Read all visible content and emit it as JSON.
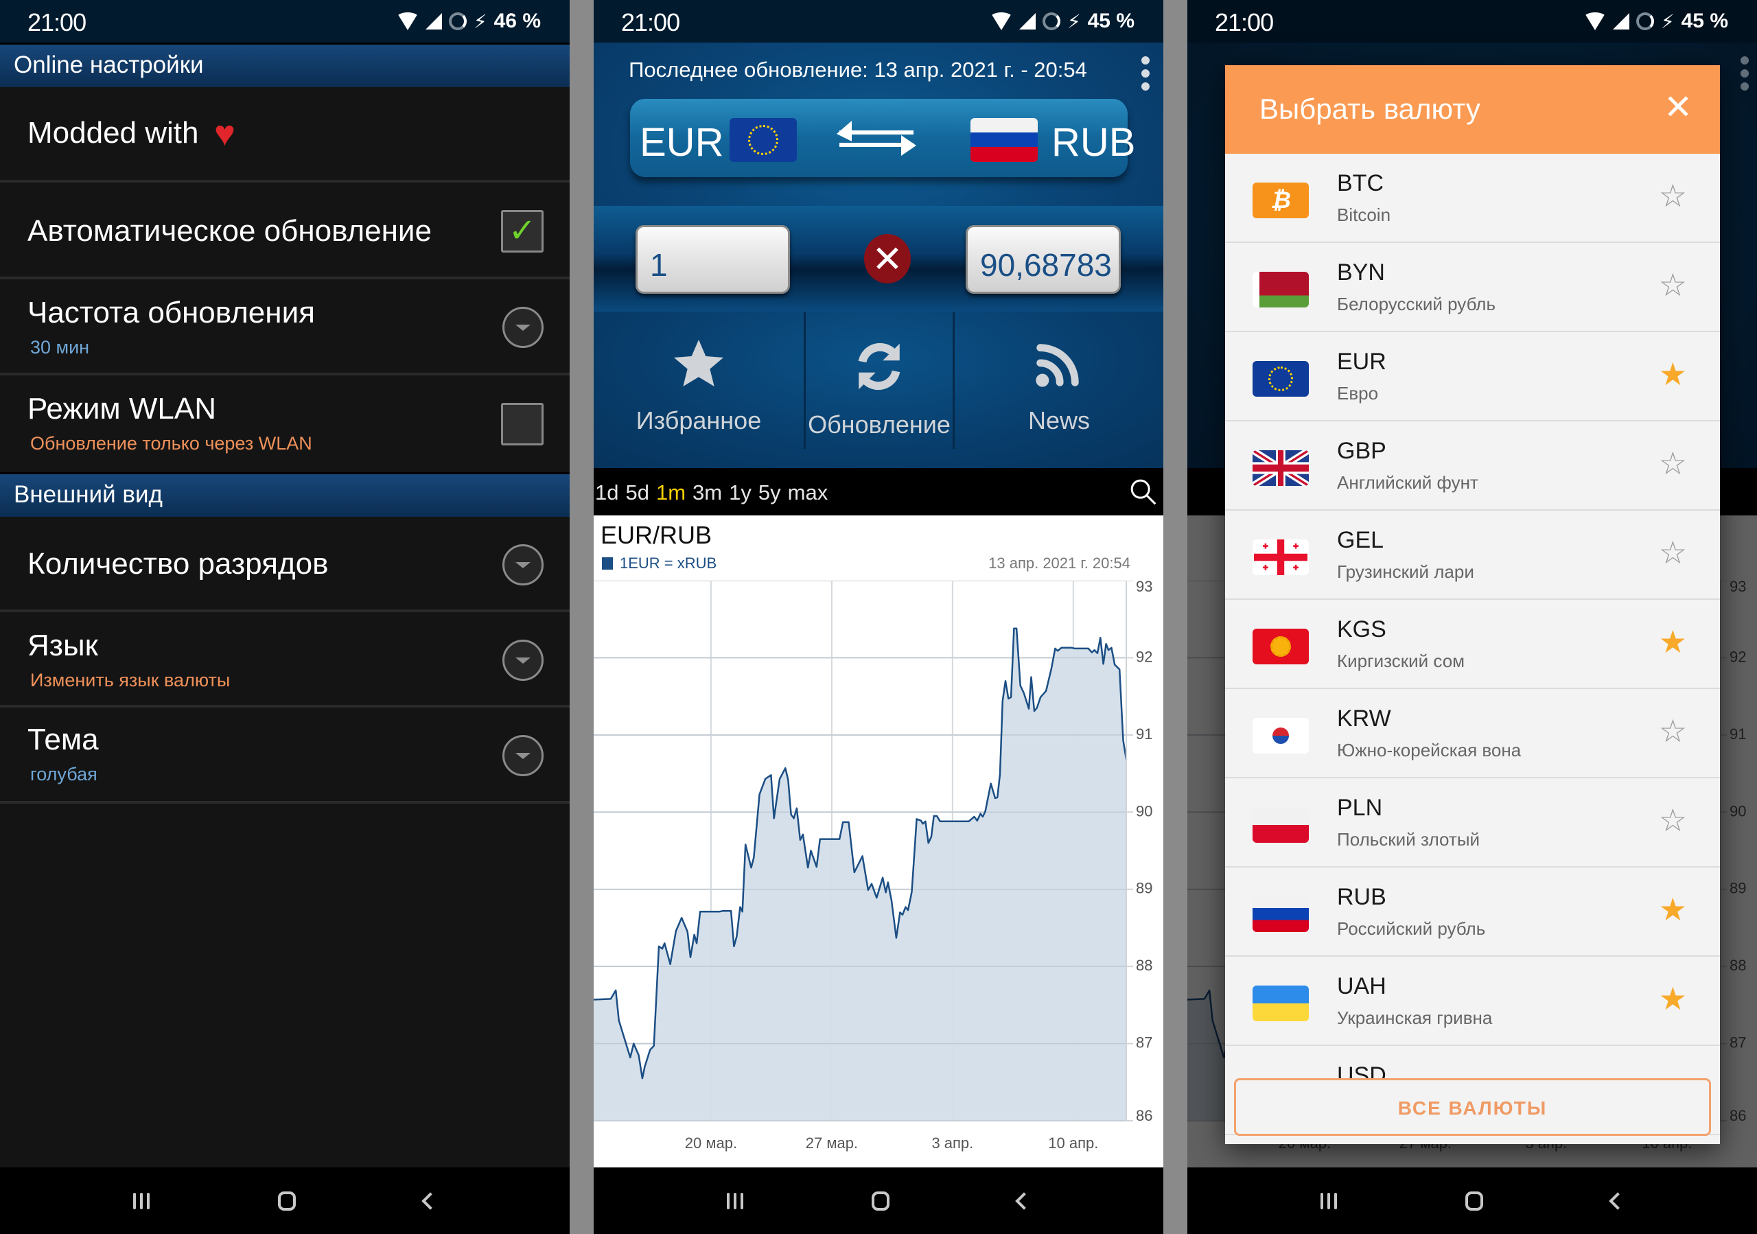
{
  "status_bars": [
    {
      "time": "21:00",
      "battery": "46 %"
    },
    {
      "time": "21:00",
      "battery": "45 %"
    },
    {
      "time": "21:00",
      "battery": "45 %"
    }
  ],
  "settings": {
    "section_online": "Online настройки",
    "modded": {
      "title": "Modded with",
      "icon": "heart-icon"
    },
    "auto_update": {
      "title": "Автоматическое обновление",
      "checked": true
    },
    "frequency": {
      "title": "Частота обновления",
      "value": "30 мин"
    },
    "wlan": {
      "title": "Режим WLAN",
      "subtitle": "Обновление только через WLAN",
      "checked": false
    },
    "section_appearance": "Внешний вид",
    "digits": {
      "title": "Количество разрядов"
    },
    "language": {
      "title": "Язык",
      "subtitle": "Изменить язык валюты"
    },
    "theme": {
      "title": "Тема",
      "value": "голубая"
    }
  },
  "converter": {
    "last_update": "Последнее обновление: 13 апр. 2021 г. - 20:54",
    "from_currency": "EUR",
    "to_currency": "RUB",
    "amount_input": "1",
    "result": "90,68783",
    "actions": [
      {
        "label": "Избранное",
        "icon": "star-icon"
      },
      {
        "label": "Обновление",
        "icon": "refresh-icon"
      },
      {
        "label": "News",
        "icon": "rss-icon"
      }
    ],
    "ranges": [
      "1d",
      "5d",
      "1m",
      "3m",
      "1y",
      "5y",
      "max"
    ],
    "active_range": "1m"
  },
  "chart_data": {
    "type": "area",
    "title": "EUR/RUB",
    "legend": "1EUR = xRUB",
    "timestamp": "13 апр. 2021 г. 20:54",
    "xlabel": "",
    "ylabel": "",
    "x_unit": "days since 20 мар. 2021",
    "xlim": [
      -6.8,
      24.07
    ],
    "ylim": [
      86,
      93
    ],
    "y_ticks": [
      86,
      87,
      88,
      89,
      90,
      91,
      92,
      93
    ],
    "x_ticks": [
      {
        "x": 0,
        "label": "20 мар."
      },
      {
        "x": 7,
        "label": "27 мар."
      },
      {
        "x": 14,
        "label": "3 апр."
      },
      {
        "x": 21,
        "label": "10 апр."
      }
    ],
    "grid": true,
    "y_axis_side": "right",
    "series": [
      {
        "name": "1EUR = xRUB",
        "color": "#1b4e84",
        "fill": "#d3dee9",
        "points": [
          [
            -6.8,
            87.57
          ],
          [
            -5.81,
            87.58
          ],
          [
            -5.52,
            87.69
          ],
          [
            -5.34,
            87.3
          ],
          [
            -4.68,
            86.82
          ],
          [
            -4.48,
            87.0
          ],
          [
            -4.19,
            86.85
          ],
          [
            -3.98,
            86.55
          ],
          [
            -3.84,
            86.7
          ],
          [
            -3.53,
            86.92
          ],
          [
            -3.31,
            86.97
          ],
          [
            -3.02,
            88.26
          ],
          [
            -2.82,
            88.23
          ],
          [
            -2.69,
            88.3
          ],
          [
            -2.36,
            88.03
          ],
          [
            -2.03,
            88.46
          ],
          [
            -1.7,
            88.63
          ],
          [
            -1.36,
            88.45
          ],
          [
            -1.19,
            88.12
          ],
          [
            -0.97,
            88.41
          ],
          [
            -0.83,
            88.3
          ],
          [
            -0.63,
            88.71
          ],
          [
            0.49,
            88.71
          ],
          [
            0.69,
            88.72
          ],
          [
            1.16,
            88.72
          ],
          [
            1.33,
            88.26
          ],
          [
            1.49,
            88.39
          ],
          [
            1.69,
            88.77
          ],
          [
            1.82,
            88.71
          ],
          [
            2.0,
            89.58
          ],
          [
            2.33,
            89.28
          ],
          [
            2.48,
            89.41
          ],
          [
            2.81,
            90.23
          ],
          [
            3.15,
            90.43
          ],
          [
            3.48,
            90.48
          ],
          [
            3.65,
            89.92
          ],
          [
            3.98,
            90.43
          ],
          [
            4.31,
            90.57
          ],
          [
            4.47,
            90.42
          ],
          [
            4.64,
            89.97
          ],
          [
            4.8,
            89.92
          ],
          [
            4.97,
            90.05
          ],
          [
            5.17,
            89.64
          ],
          [
            5.33,
            89.71
          ],
          [
            5.62,
            89.28
          ],
          [
            5.79,
            89.5
          ],
          [
            6.12,
            89.29
          ],
          [
            6.32,
            89.65
          ],
          [
            7.45,
            89.65
          ],
          [
            7.65,
            89.87
          ],
          [
            7.98,
            89.87
          ],
          [
            8.31,
            89.22
          ],
          [
            8.78,
            89.43
          ],
          [
            9.11,
            88.99
          ],
          [
            9.31,
            89.07
          ],
          [
            9.6,
            88.89
          ],
          [
            9.95,
            89.15
          ],
          [
            10.13,
            88.96
          ],
          [
            10.26,
            89.09
          ],
          [
            10.46,
            88.86
          ],
          [
            10.74,
            88.37
          ],
          [
            10.96,
            88.7
          ],
          [
            11.1,
            88.67
          ],
          [
            11.28,
            88.77
          ],
          [
            11.42,
            88.73
          ],
          [
            11.58,
            88.9
          ],
          [
            11.64,
            88.97
          ],
          [
            11.92,
            89.91
          ],
          [
            12.17,
            89.89
          ],
          [
            12.28,
            89.85
          ],
          [
            12.43,
            89.88
          ],
          [
            12.6,
            89.6
          ],
          [
            12.77,
            89.68
          ],
          [
            12.92,
            89.95
          ],
          [
            13.09,
            89.95
          ],
          [
            13.28,
            89.88
          ],
          [
            14.3,
            89.88
          ],
          [
            14.51,
            89.88
          ],
          [
            14.94,
            89.88
          ],
          [
            15.26,
            89.94
          ],
          [
            15.43,
            89.89
          ],
          [
            15.62,
            89.98
          ],
          [
            15.75,
            89.94
          ],
          [
            15.9,
            90.01
          ],
          [
            16.22,
            90.37
          ],
          [
            16.47,
            90.18
          ],
          [
            16.6,
            90.19
          ],
          [
            16.75,
            90.49
          ],
          [
            16.9,
            91.44
          ],
          [
            17.07,
            91.7
          ],
          [
            17.24,
            91.47
          ],
          [
            17.39,
            91.49
          ],
          [
            17.56,
            92.38
          ],
          [
            17.71,
            92.38
          ],
          [
            17.93,
            91.64
          ],
          [
            18.14,
            91.54
          ],
          [
            18.42,
            91.34
          ],
          [
            18.56,
            91.75
          ],
          [
            18.74,
            91.31
          ],
          [
            18.89,
            91.35
          ],
          [
            19.1,
            91.49
          ],
          [
            19.42,
            91.57
          ],
          [
            19.73,
            91.86
          ],
          [
            19.95,
            92.12
          ],
          [
            20.1,
            92.09
          ],
          [
            20.31,
            92.13
          ],
          [
            20.91,
            92.13
          ],
          [
            21.08,
            92.12
          ],
          [
            21.87,
            92.12
          ],
          [
            22.08,
            92.07
          ],
          [
            22.23,
            92.1
          ],
          [
            22.4,
            92.06
          ],
          [
            22.57,
            92.26
          ],
          [
            22.74,
            91.92
          ],
          [
            22.9,
            92.18
          ],
          [
            23.04,
            92.1
          ],
          [
            23.21,
            92.13
          ],
          [
            23.4,
            91.91
          ],
          [
            23.68,
            91.85
          ],
          [
            23.89,
            90.93
          ],
          [
            24.07,
            90.68
          ]
        ]
      }
    ]
  },
  "currency_dialog": {
    "title": "Выбрать валюту",
    "close_icon": "close-icon",
    "items": [
      {
        "code": "BTC",
        "name": "Bitcoin",
        "flag": "btc",
        "favorite": false
      },
      {
        "code": "BYN",
        "name": "Белорусский рубль",
        "flag": "by",
        "favorite": false
      },
      {
        "code": "EUR",
        "name": "Евро",
        "flag": "eu",
        "favorite": true
      },
      {
        "code": "GBP",
        "name": "Английский фунт",
        "flag": "gb",
        "favorite": false
      },
      {
        "code": "GEL",
        "name": "Грузинский лари",
        "flag": "ge",
        "favorite": false
      },
      {
        "code": "KGS",
        "name": "Киргизский сом",
        "flag": "kg",
        "favorite": true
      },
      {
        "code": "KRW",
        "name": "Южно-корейская вона",
        "flag": "kr",
        "favorite": false
      },
      {
        "code": "PLN",
        "name": "Польский злотый",
        "flag": "pl",
        "favorite": false
      },
      {
        "code": "RUB",
        "name": "Российский рубль",
        "flag": "ru",
        "favorite": true
      },
      {
        "code": "UAH",
        "name": "Украинская гривна",
        "flag": "ua",
        "favorite": true
      },
      {
        "code": "USD",
        "name": "",
        "flag": "",
        "favorite": false
      }
    ],
    "all_button": "ВСЕ ВАЛЮТЫ"
  },
  "colors": {
    "accent_orange": "#fb9a52",
    "favorite_star": "#f8a92a",
    "subtitle_blue": "#6fa6d6",
    "subtitle_orange": "#f0915a",
    "active_range": "#f5d000",
    "line": "#1b4e84"
  }
}
